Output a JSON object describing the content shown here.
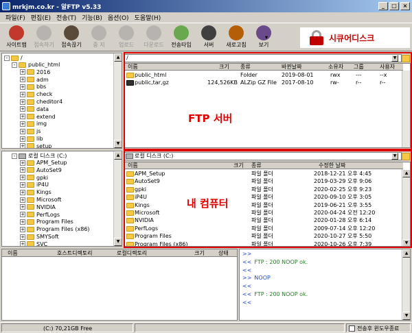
{
  "window": {
    "title": "mrkjm.co.kr - 알FTP v5.33",
    "controls": [
      "_",
      "□",
      "×"
    ]
  },
  "menu": [
    "파일(F)",
    "편집(E)",
    "전송(T)",
    "기능(B)",
    "옵션(O)",
    "도움말(H)"
  ],
  "toolbar": {
    "buttons": [
      {
        "label": "사이트맵",
        "enabled": true,
        "icon": "sitemap-icon",
        "color": "#c0392b"
      },
      {
        "label": "접속하기",
        "enabled": false,
        "icon": "connect-icon",
        "color": "#808080"
      },
      {
        "label": "접속끊기",
        "enabled": true,
        "icon": "disconnect-icon",
        "color": "#5a4a3a"
      },
      {
        "label": "중 지",
        "enabled": false,
        "icon": "stop-icon",
        "color": "#808080"
      },
      {
        "label": "업로드",
        "enabled": false,
        "icon": "upload-icon",
        "color": "#808080"
      },
      {
        "label": "다운로드",
        "enabled": false,
        "icon": "download-icon",
        "color": "#808080"
      },
      {
        "label": "전송타입",
        "enabled": true,
        "icon": "transfer-type-icon",
        "color": "#6aa84f"
      },
      {
        "label": "서버",
        "enabled": true,
        "icon": "server-icon",
        "color": "#404040"
      },
      {
        "label": "새로고침",
        "enabled": true,
        "icon": "refresh-icon",
        "color": "#b45f06"
      },
      {
        "label": "보기",
        "enabled": true,
        "icon": "view-icon",
        "color": "#6a4a8a"
      }
    ],
    "dropdown": "▾"
  },
  "security": {
    "label": "시큐어디스크"
  },
  "remote_tree": {
    "root": "/",
    "items": [
      "public_html",
      "2016",
      "adm",
      "bbs",
      "check",
      "cheditor4",
      "data",
      "extend",
      "img",
      "js",
      "lib",
      "setup"
    ]
  },
  "remote": {
    "path": "/",
    "columns": [
      "이름",
      "크기",
      "종류",
      "바뀐날짜",
      "소유자",
      "그룹",
      "사용자"
    ],
    "rows": [
      {
        "name": "public_html",
        "size": "",
        "type": "Folder",
        "date": "2019-08-01",
        "owner": "rwx",
        "group": "---",
        "user": "--x"
      },
      {
        "name": "public,tar,gz",
        "size": "124,526KB",
        "type": "ALZip GZ File",
        "date": "2017-08-10",
        "owner": "rw-",
        "group": "r--",
        "user": "r--"
      }
    ],
    "label": "FTP 서버"
  },
  "local_tree": {
    "drive": "로컬 디스크 (C:)",
    "items": [
      "APM_Setup",
      "AutoSet9",
      "gpki",
      "iP4U",
      "Kings",
      "Microsoft",
      "NVIDIA",
      "PerfLogs",
      "Program Files",
      "Program Files (x86)",
      "SMYSoft",
      "SVC"
    ]
  },
  "local": {
    "path": "로컬 디스크 (C:)",
    "columns": [
      "이름",
      "크기",
      "종류",
      "수정한 날짜"
    ],
    "rows": [
      {
        "name": "APM_Setup",
        "type": "파일 폴더",
        "date": "2018-12-21 오후 4:45"
      },
      {
        "name": "AutoSet9",
        "type": "파일 폴더",
        "date": "2019-03-29 오후 9:06"
      },
      {
        "name": "gpki",
        "type": "파일 폴더",
        "date": "2020-02-25 오후 9:23"
      },
      {
        "name": "iP4U",
        "type": "파일 폴더",
        "date": "2020-09-10 오후 3:05"
      },
      {
        "name": "Kings",
        "type": "파일 폴더",
        "date": "2019-06-21 오후 3:55"
      },
      {
        "name": "Microsoft",
        "type": "파일 폴더",
        "date": "2020-04-24 오전 12:20"
      },
      {
        "name": "NVIDIA",
        "type": "파일 폴더",
        "date": "2020-01-28 오후 6:14"
      },
      {
        "name": "PerfLogs",
        "type": "파일 폴더",
        "date": "2009-07-14 오후 12:20"
      },
      {
        "name": "Program Files",
        "type": "파일 폴더",
        "date": "2020-10-27 오후 5:50"
      },
      {
        "name": "Program Files (x86)",
        "type": "파일 폴더",
        "date": "2020-10-26 오후 7:39"
      }
    ],
    "label": "내 컴퓨터"
  },
  "queue": {
    "columns": [
      "이름",
      "호스트디렉토리",
      "로컬디렉토리",
      "크기",
      "상태"
    ]
  },
  "log": [
    {
      "prefix": ">>",
      "text": ""
    },
    {
      "prefix": "<<",
      "text": "FTP : 200 NOOP ok."
    },
    {
      "prefix": "<<",
      "text": ""
    },
    {
      "prefix": ">>",
      "text": "NOOP"
    },
    {
      "prefix": "<<",
      "text": ""
    },
    {
      "prefix": "<<",
      "text": "FTP : 200 NOOP ok."
    },
    {
      "prefix": "<<",
      "text": ""
    }
  ],
  "status": {
    "disk": "(C:)  70,21GB Free",
    "close_after": "전송후 윈도우종료"
  }
}
